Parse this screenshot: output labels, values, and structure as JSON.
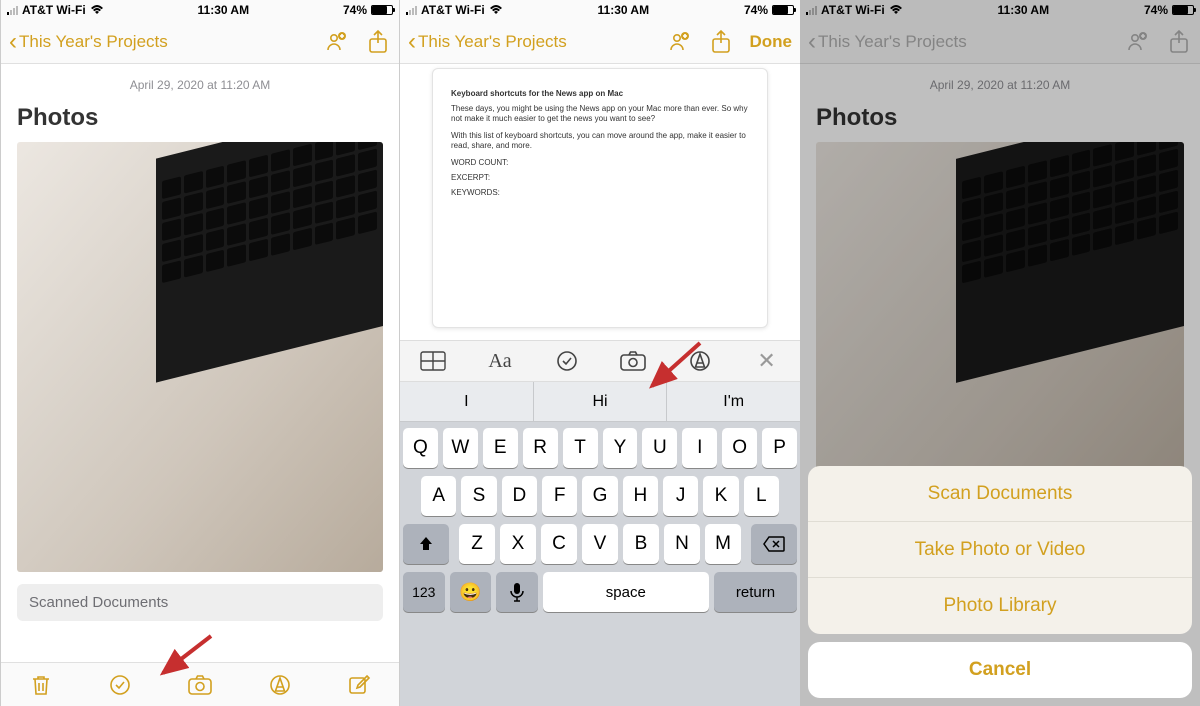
{
  "status": {
    "carrier": "AT&T Wi-Fi",
    "time": "11:30 AM",
    "battery_pct": "74%"
  },
  "nav": {
    "back_label": "This Year's Projects",
    "done": "Done"
  },
  "note": {
    "timestamp": "April 29, 2020 at 11:20 AM",
    "title": "Photos",
    "scanned_label": "Scanned Documents"
  },
  "doc": {
    "heading": "Keyboard shortcuts for the News app on Mac",
    "p1": "These days, you might be using the News app on your Mac more than ever. So why not make it much easier to get the news you want to see?",
    "p2": "With this list of keyboard shortcuts, you can move around the app, make it easier to read, share, and more.",
    "wc": "WORD COUNT:",
    "ex": "EXCERPT:",
    "kw": "KEYWORDS:"
  },
  "format_bar": {
    "aa": "Aa"
  },
  "suggestions": {
    "s1": "I",
    "s2": "Hi",
    "s3": "I'm"
  },
  "keyboard": {
    "row1": [
      "Q",
      "W",
      "E",
      "R",
      "T",
      "Y",
      "U",
      "I",
      "O",
      "P"
    ],
    "row2": [
      "A",
      "S",
      "D",
      "F",
      "G",
      "H",
      "J",
      "K",
      "L"
    ],
    "row3": [
      "Z",
      "X",
      "C",
      "V",
      "B",
      "N",
      "M"
    ],
    "num": "123",
    "space": "space",
    "return": "return"
  },
  "sheet": {
    "scan": "Scan Documents",
    "take": "Take Photo or Video",
    "lib": "Photo Library",
    "cancel": "Cancel"
  }
}
